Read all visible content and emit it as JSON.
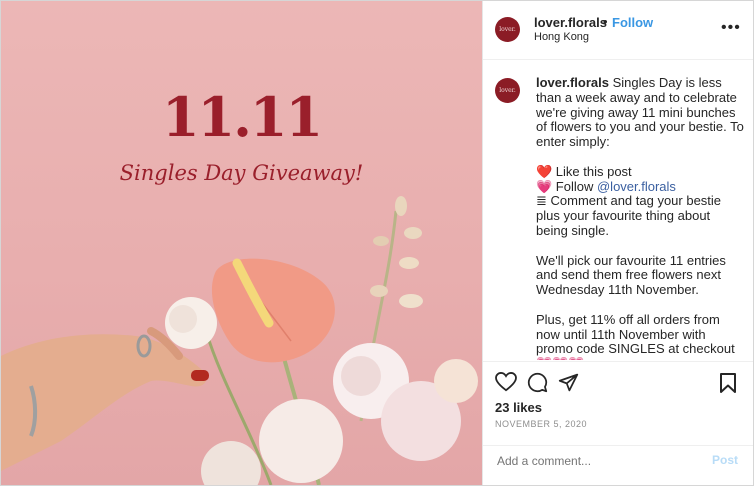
{
  "photo": {
    "headline": "11.11",
    "subline": "Singles Day Giveaway!"
  },
  "header": {
    "avatar_text": "lover.",
    "username": "lover.florals",
    "separator": "•",
    "follow_label": "Follow",
    "location": "Hong Kong",
    "more_icon": "more-horizontal-icon"
  },
  "caption": {
    "username": "lover.florals",
    "intro": " Singles Day is less than a week away and to celebrate we're giving away 11 mini bunches of flowers to you and your bestie. To enter simply:",
    "step1": "❤️ Like this post",
    "step2_prefix": "💗 Follow ",
    "step2_mention": "@lover.florals",
    "step3": "≣ Comment and tag your bestie plus your favourite thing about being single.",
    "para2": "We'll pick our favourite 11 entries and send them free flowers next Wednesday 11th November.",
    "para3": "Plus, get 11% off all orders from now until 11th November with promo code SINGLES at checkout 💗💗💗"
  },
  "actions": {
    "like_icon": "heart-icon",
    "comment_icon": "comment-icon",
    "share_icon": "paper-plane-icon",
    "save_icon": "bookmark-icon",
    "likes": "23 likes",
    "date": "NOVEMBER 5, 2020"
  },
  "comment_box": {
    "placeholder": "Add a comment...",
    "post_label": "Post"
  }
}
